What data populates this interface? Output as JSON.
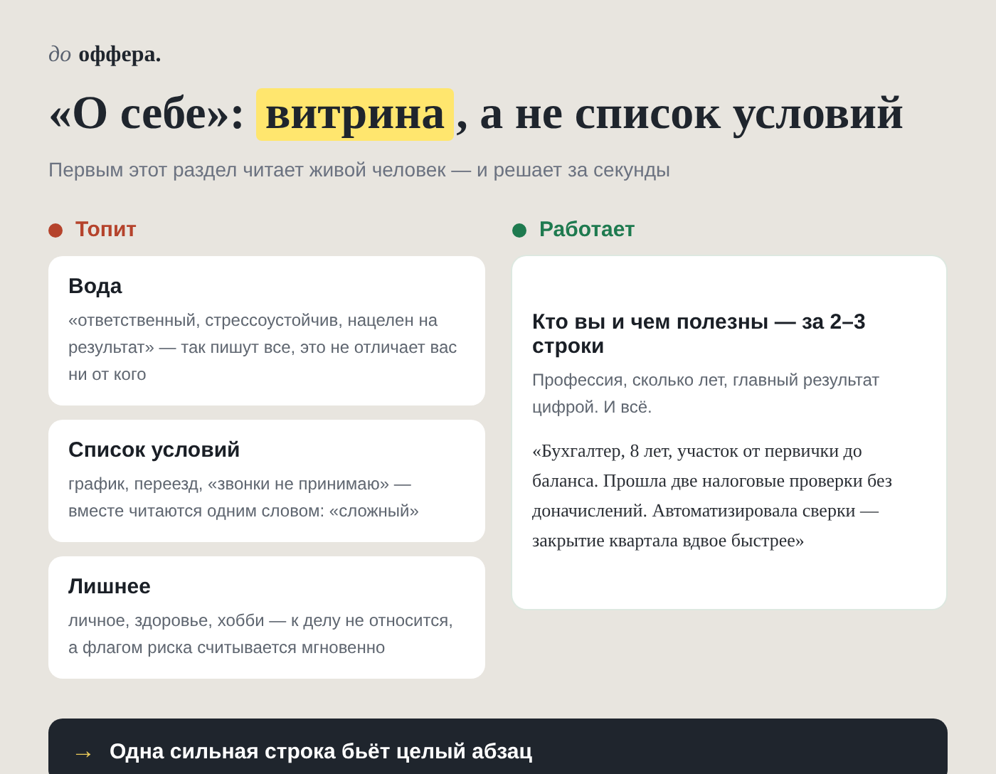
{
  "brand": {
    "prefix": "до",
    "name": "оффера."
  },
  "title": {
    "before": "«О себе»:",
    "highlight": "витрина",
    "after": ", а не список условий"
  },
  "subtitle": "Первым этот раздел читает живой человек — и решает за секунды",
  "bad": {
    "label": "Топит",
    "color": "#b5432c",
    "cards": [
      {
        "title": "Вода",
        "text": "«ответственный, стрессоустойчив, нацелен на результат» — так пишут все, это не отличает вас ни от кого"
      },
      {
        "title": "Список условий",
        "text": "график, переезд, «звонки не принимаю» — вместе читаются одним словом: «сложный»"
      },
      {
        "title": "Лишнее",
        "text": "личное, здоровье, хобби — к делу не относится, а флагом риска считывается мгновенно"
      }
    ]
  },
  "good": {
    "label": "Работает",
    "color": "#1e7a4f",
    "card": {
      "title": "Кто вы и чем полезны — за 2–3 строки",
      "text": "Профессия, сколько лет, главный результат цифрой. И всё.",
      "quote": "«Бухгалтер, 8 лет, участок от первички до баланса. Прошла две налоговые проверки без доначислений. Автоматизировала сверки — закрытие квартала вдвое быстрее»"
    }
  },
  "footer": {
    "arrow": "→",
    "text": "Одна сильная строка бьёт целый абзац"
  }
}
